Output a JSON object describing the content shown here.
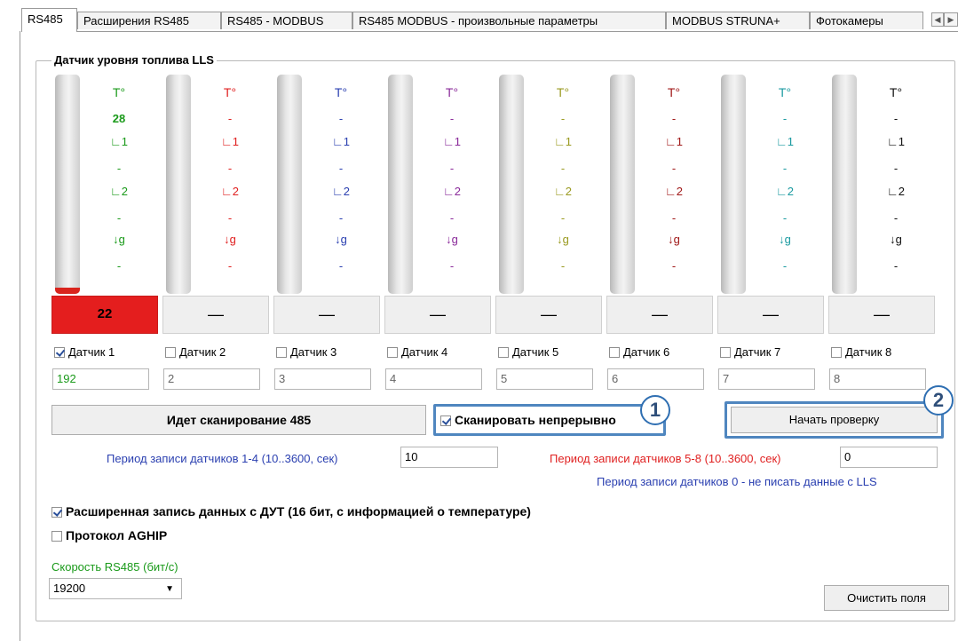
{
  "tabs": [
    {
      "label": "RS485",
      "active": true
    },
    {
      "label": "Расширения RS485",
      "active": false
    },
    {
      "label": "RS485 - MODBUS",
      "active": false
    },
    {
      "label": "RS485 MODBUS - произвольные параметры",
      "active": false
    },
    {
      "label": "MODBUS STRUNA+",
      "active": false
    },
    {
      "label": "Фотокамеры",
      "active": false
    }
  ],
  "group_title": "Датчик уровня топлива LLS",
  "sensors": [
    {
      "color": "#1a9a1a",
      "temp_label": "T°",
      "temp": "28",
      "l1_label": "∟1",
      "l1": "-",
      "l2_label": "∟2",
      "l2": "-",
      "g_label": "↓g",
      "g": "-",
      "level": "22",
      "fill": 0.03,
      "button": "22",
      "check": "Датчик 1",
      "checked": true,
      "address": "192",
      "address_color": "#1a9a1a"
    },
    {
      "color": "#e02020",
      "temp_label": "T°",
      "temp": "-",
      "l1_label": "∟1",
      "l1": "-",
      "l2_label": "∟2",
      "l2": "-",
      "g_label": "↓g",
      "g": "-",
      "fill": 0,
      "button": "—",
      "check": "Датчик 2",
      "checked": false,
      "address": "2",
      "address_color": "#666666"
    },
    {
      "color": "#2a3fb0",
      "temp_label": "T°",
      "temp": "-",
      "l1_label": "∟1",
      "l1": "-",
      "l2_label": "∟2",
      "l2": "-",
      "g_label": "↓g",
      "g": "-",
      "fill": 0,
      "button": "—",
      "check": "Датчик 3",
      "checked": false,
      "address": "3",
      "address_color": "#666666"
    },
    {
      "color": "#8a2a9a",
      "temp_label": "T°",
      "temp": "-",
      "l1_label": "∟1",
      "l1": "-",
      "l2_label": "∟2",
      "l2": "-",
      "g_label": "↓g",
      "g": "-",
      "fill": 0,
      "button": "—",
      "check": "Датчик 4",
      "checked": false,
      "address": "4",
      "address_color": "#666666"
    },
    {
      "color": "#9a9a20",
      "temp_label": "T°",
      "temp": "-",
      "l1_label": "∟1",
      "l1": "-",
      "l2_label": "∟2",
      "l2": "-",
      "g_label": "↓g",
      "g": "-",
      "fill": 0,
      "button": "—",
      "check": "Датчик 5",
      "checked": false,
      "address": "5",
      "address_color": "#666666"
    },
    {
      "color": "#a01818",
      "temp_label": "T°",
      "temp": "-",
      "l1_label": "∟1",
      "l1": "-",
      "l2_label": "∟2",
      "l2": "-",
      "g_label": "↓g",
      "g": "-",
      "fill": 0,
      "button": "—",
      "check": "Датчик 6",
      "checked": false,
      "address": "6",
      "address_color": "#666666"
    },
    {
      "color": "#1a9aa0",
      "temp_label": "T°",
      "temp": "-",
      "l1_label": "∟1",
      "l1": "-",
      "l2_label": "∟2",
      "l2": "-",
      "g_label": "↓g",
      "g": "-",
      "fill": 0,
      "button": "—",
      "check": "Датчик 7",
      "checked": false,
      "address": "7",
      "address_color": "#666666"
    },
    {
      "color": "#111111",
      "temp_label": "T°",
      "temp": "-",
      "l1_label": "∟1",
      "l1": "-",
      "l2_label": "∟2",
      "l2": "-",
      "g_label": "↓g",
      "g": "-",
      "fill": 0,
      "button": "—",
      "check": "Датчик 8",
      "checked": false,
      "address": "8",
      "address_color": "#666666"
    }
  ],
  "scan": {
    "status_button": "Идет сканирование 485",
    "continuous_label": "Сканировать непрерывно",
    "continuous_checked": true,
    "start_check_button": "Начать проверку",
    "callout_1": "1",
    "callout_2": "2"
  },
  "period": {
    "label_1_4": "Период записи датчиков 1-4 (10..3600, сек)",
    "value_1_4": "10",
    "label_1_4_color": "#2a3fb0",
    "label_5_8": "Период записи датчиков 5-8 (10..3600, сек)",
    "value_5_8": "0",
    "label_5_8_color": "#e02020",
    "hint": "Период записи датчиков 0 - не писать данные с LLS",
    "hint_color": "#2a3fb0"
  },
  "options": {
    "extended_label": "Расширенная запись данных с ДУТ (16 бит, с информацией о температуре)",
    "extended_checked": true,
    "aghip_label": "Протокол AGHIP",
    "aghip_checked": false
  },
  "speed": {
    "label": "Скорость RS485 (бит/с)",
    "label_color": "#1a9a1a",
    "value": "19200"
  },
  "clear_button": "Очистить поля"
}
